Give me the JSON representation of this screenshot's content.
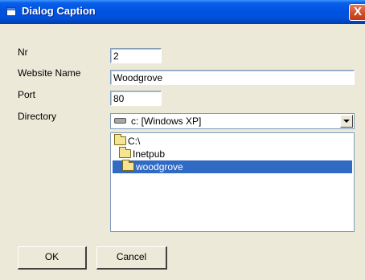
{
  "window": {
    "title": "Dialog Caption",
    "close_glyph": "X"
  },
  "fields": {
    "nr": {
      "label": "Nr",
      "value": "2"
    },
    "website_name": {
      "label": "Website Name",
      "value": "Woodgrove"
    },
    "port": {
      "label": "Port",
      "value": "80"
    },
    "directory": {
      "label": "Directory"
    }
  },
  "drive": {
    "selected": "c: [Windows XP]",
    "icon": "hard-drive-icon"
  },
  "tree": [
    {
      "label": "C:\\",
      "icon": "open-folder-icon"
    },
    {
      "label": "Inetpub",
      "icon": "open-folder-icon"
    },
    {
      "label": "woodgrove",
      "icon": "open-folder-icon",
      "selected": true
    }
  ],
  "buttons": {
    "ok": "OK",
    "cancel": "Cancel"
  }
}
